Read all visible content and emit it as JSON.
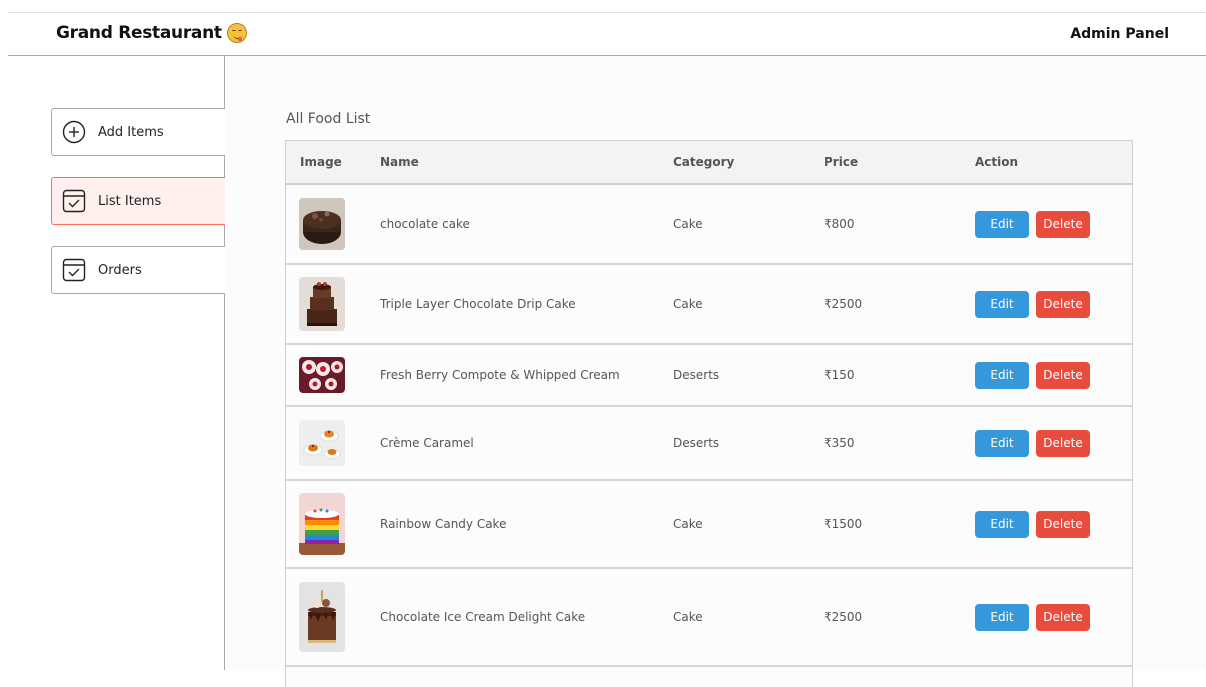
{
  "navbar": {
    "brand_name": "Grand Restaurant",
    "panel_label": "Admin Panel"
  },
  "sidebar": {
    "items": [
      {
        "label": "Add Items",
        "icon": "plus-circle-icon",
        "active": false
      },
      {
        "label": "List Items",
        "icon": "checklist-icon",
        "active": true
      },
      {
        "label": "Orders",
        "icon": "checklist-icon",
        "active": false
      }
    ]
  },
  "main": {
    "title": "All Food List",
    "table": {
      "columns": [
        "Image",
        "Name",
        "Category",
        "Price",
        "Action"
      ],
      "rows": [
        {
          "name": "chocolate cake",
          "category": "Cake",
          "price": "₹800",
          "image": "chocolate-cake-image"
        },
        {
          "name": "Triple Layer Chocolate Drip Cake",
          "category": "Cake",
          "price": "₹2500",
          "image": "triple-layer-cake-image"
        },
        {
          "name": "Fresh Berry Compote & Whipped Cream",
          "category": "Deserts",
          "price": "₹150",
          "image": "berry-compote-image"
        },
        {
          "name": "Crème Caramel",
          "category": "Deserts",
          "price": "₹350",
          "image": "creme-caramel-image"
        },
        {
          "name": "Rainbow Candy Cake",
          "category": "Cake",
          "price": "₹1500",
          "image": "rainbow-cake-image"
        },
        {
          "name": "Chocolate Ice Cream Delight Cake",
          "category": "Cake",
          "price": "₹2500",
          "image": "ice-cream-cake-image"
        }
      ],
      "edit_label": "Edit",
      "delete_label": "Delete"
    }
  },
  "colors": {
    "accent": "#ff6b5a",
    "active_bg": "#fff0ee",
    "edit": "#3498db",
    "delete": "#e74c3c"
  }
}
